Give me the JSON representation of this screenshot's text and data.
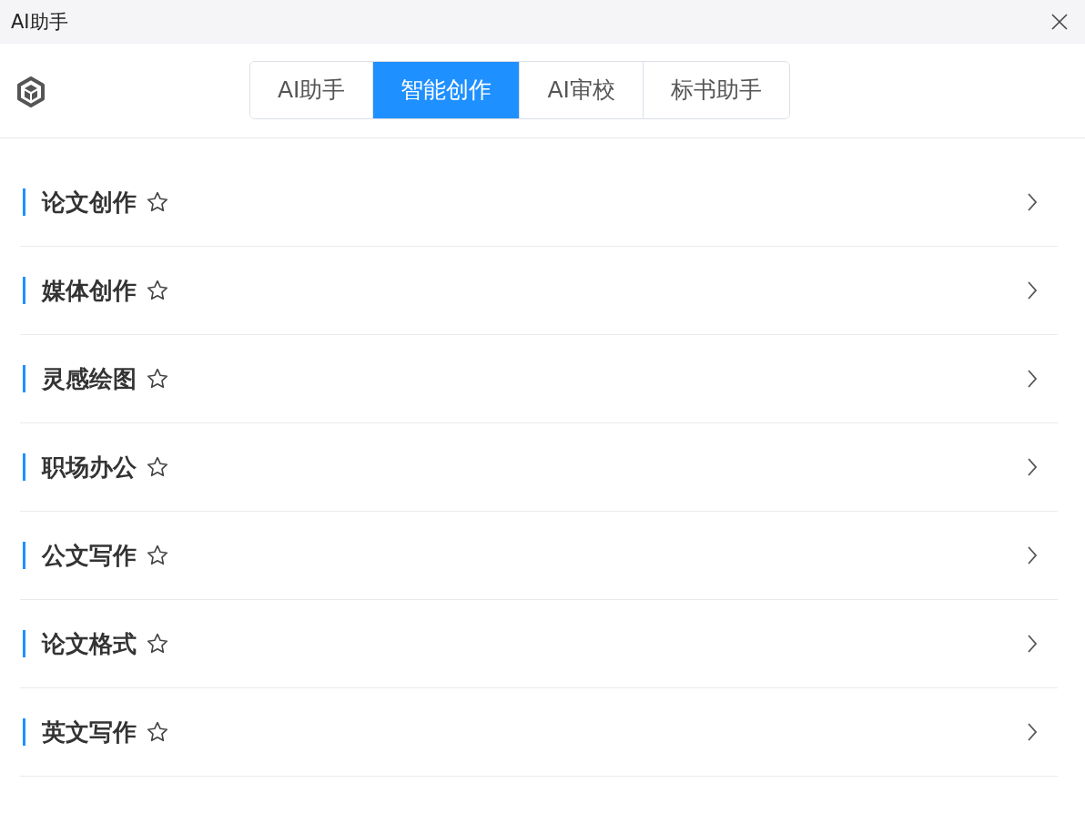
{
  "window": {
    "title": "AI助手"
  },
  "tabs": [
    {
      "label": "AI助手",
      "selected": false
    },
    {
      "label": "智能创作",
      "selected": true
    },
    {
      "label": "AI审校",
      "selected": false
    },
    {
      "label": "标书助手",
      "selected": false
    }
  ],
  "categories": [
    {
      "label": "论文创作",
      "favorite": false
    },
    {
      "label": "媒体创作",
      "favorite": false
    },
    {
      "label": "灵感绘图",
      "favorite": false
    },
    {
      "label": "职场办公",
      "favorite": false
    },
    {
      "label": "公文写作",
      "favorite": false
    },
    {
      "label": "论文格式",
      "favorite": false
    },
    {
      "label": "英文写作",
      "favorite": false
    }
  ]
}
